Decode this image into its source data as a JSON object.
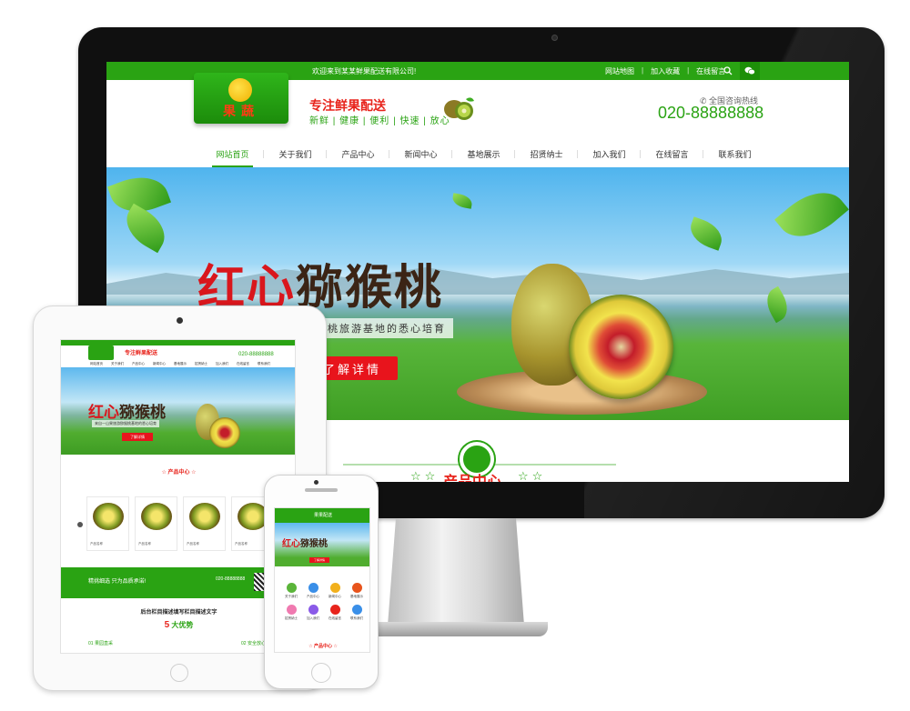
{
  "desktop": {
    "topbar": {
      "welcome": "欢迎来到某某鲜果配送有限公司!",
      "links": [
        "网站地图",
        "加入收藏",
        "在线留言"
      ]
    },
    "logo_text": "果蔬",
    "slogan_main": "专注鲜果配送",
    "slogan_sub": "新鲜 | 健康 | 便利 | 快速 | 放心",
    "hotline_label": "全国咨询热线",
    "hotline_number": "020-88888888",
    "nav": [
      "网站首页",
      "关于我们",
      "产品中心",
      "新闻中心",
      "基地展示",
      "招贤纳士",
      "加入我们",
      "在线留言",
      "联系我们"
    ],
    "banner": {
      "title_red": "红心",
      "title_dark": "猕猴桃",
      "subtitle": "猴桃旅游基地的悉心培育",
      "button": "了解详情"
    },
    "section_title": "产品中心",
    "stars": "☆☆"
  },
  "tablet": {
    "slogan": "专注鲜果配送",
    "phone": "020-88888888",
    "nav": [
      "网站首页",
      "关于我们",
      "产品中心",
      "新闻中心",
      "基地展示",
      "招贤纳士",
      "加入我们",
      "在线留言",
      "联系我们"
    ],
    "banner_title_red": "红心",
    "banner_title_dark": "猕猴桃",
    "banner_sub": "来自一山果旅游猕猴桃基地的悉心培育",
    "banner_button": "了解详情",
    "section_title": "产品中心",
    "product_label": "产品名称",
    "greenbar_text": "精挑细选 只为品质承诺!",
    "greenbar_phone": "020-88888888",
    "desc_title": "后台栏目描述填写栏目描述文字",
    "advantage_prefix": "",
    "advantage_num": "5",
    "advantage_suffix": "大优势",
    "adv1": "01 果园直采",
    "adv2": "02 安全放心"
  },
  "phone": {
    "header": "果果配送",
    "banner_title_red": "红心",
    "banner_title_dark": "猕猴桃",
    "banner_button": "了解详情",
    "grid": [
      "关于我们",
      "产品中心",
      "新闻中心",
      "基地展示",
      "招贤纳士",
      "加入我们",
      "在线留言",
      "联系我们"
    ],
    "section_title": "产品中心"
  },
  "colors": {
    "brand_green": "#2aa313",
    "accent_red": "#e8141c",
    "grid_icon_colors": [
      "#5bb53a",
      "#3a8fe8",
      "#f2b01c",
      "#e8541c",
      "#f07ab0",
      "#8a5ae8",
      "#e8241c",
      "#3a8fe8"
    ]
  }
}
